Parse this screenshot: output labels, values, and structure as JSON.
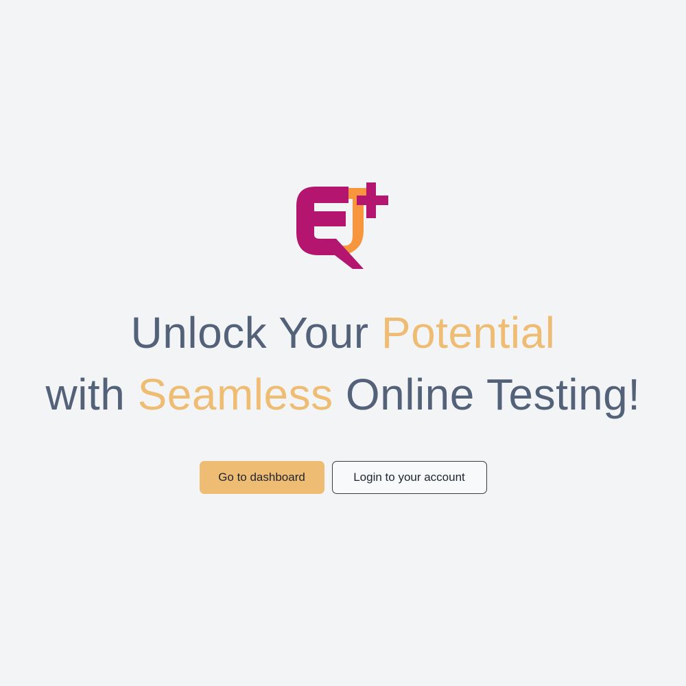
{
  "colors": {
    "background": "#f2f4f6",
    "text": "#536279",
    "accent": "#efbc73",
    "logo_magenta": "#b4156e",
    "logo_orange": "#f7963e"
  },
  "logo": {
    "icon": "eq-plus-logo"
  },
  "headline": {
    "line1_part1": "Unlock Your ",
    "line1_accent": "Potential",
    "line2_part1": "with ",
    "line2_accent": "Seamless",
    "line2_part2": " Online Testing!"
  },
  "actions": {
    "dashboard_label": "Go to dashboard",
    "login_label": "Login to your account"
  }
}
